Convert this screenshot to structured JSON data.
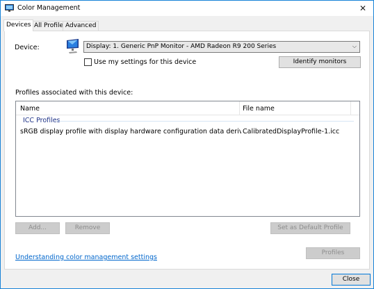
{
  "window": {
    "title": "Color Management",
    "close_glyph": "✕"
  },
  "tabs": [
    {
      "label": "Devices",
      "active": true
    },
    {
      "label": "All Profiles",
      "active": false
    },
    {
      "label": "Advanced",
      "active": false
    }
  ],
  "device": {
    "label": "Device:",
    "selected": "Display: 1. Generic PnP Monitor - AMD Radeon R9 200 Series",
    "icon": "monitor-icon"
  },
  "settings": {
    "use_my_settings_label": "Use my settings for this device",
    "use_my_settings_checked": false,
    "identify_label": "Identify monitors"
  },
  "profiles": {
    "section_label": "Profiles associated with this device:",
    "columns": {
      "name": "Name",
      "file": "File name"
    },
    "group": "ICC Profiles",
    "rows": [
      {
        "name": "sRGB display profile with display hardware configuration data derived from cali...",
        "file": "CalibratedDisplayProfile-1.icc"
      }
    ]
  },
  "actions": {
    "add_label": "Add...",
    "remove_label": "Remove",
    "set_default_label": "Set as Default Profile",
    "profiles_label": "Profiles"
  },
  "footer": {
    "link_label": "Understanding color management settings",
    "close_label": "Close"
  },
  "colors": {
    "accent": "#0078d7",
    "link": "#0066cc",
    "group_label": "#1e3287"
  }
}
